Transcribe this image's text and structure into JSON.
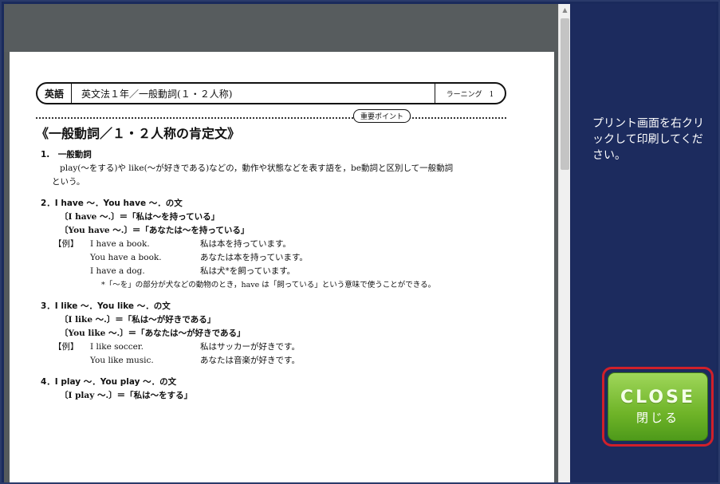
{
  "instruction": "プリント画面を右クリックして印刷してください。",
  "close_button": {
    "label_en": "CLOSE",
    "label_ja": "閉じる"
  },
  "document": {
    "subject": "英語",
    "title": "英文法１年／一般動詞(１・２人称)",
    "right_label": "ラーニング　1",
    "point_tag": "重要ポイント",
    "main_heading": "《一般動詞／１・２人称の肯定文》",
    "sections": [
      {
        "title": "1.　一般動詞",
        "lines": [
          "play(～をする)や like(～が好きである)などの，動作や状態などを表す語を，be動詞と区別して一般動詞",
          "という。"
        ]
      },
      {
        "title": "2．I have ～．You have ～．の文",
        "patterns": [
          "〔I have ～.〕＝「私は～を持っている」",
          "〔You have ～.〕＝「あなたは～を持っている」"
        ],
        "example_label": "【例】",
        "examples": [
          {
            "en": "I have a book.",
            "ja": "私は本を持っています。"
          },
          {
            "en": "You have a book.",
            "ja": "あなたは本を持っています。"
          },
          {
            "en": "I have a dog.",
            "ja": "私は犬*を飼っています。"
          }
        ],
        "note": "*「～を」の部分が犬などの動物のとき，have は「飼っている」という意味で使うことができる。"
      },
      {
        "title": "3．I like ～．You like ～．の文",
        "patterns": [
          "〔I like ～.〕＝「私は～が好きである」",
          "〔You like ～.〕＝「あなたは～が好きである」"
        ],
        "example_label": "【例】",
        "examples": [
          {
            "en": "I like soccer.",
            "ja": "私はサッカーが好きです。"
          },
          {
            "en": "You like music.",
            "ja": "あなたは音楽が好きです。"
          }
        ]
      },
      {
        "title": "4．I play ～．You play ～．の文",
        "patterns": [
          "〔I play ～.〕＝「私は～をする」"
        ]
      }
    ]
  }
}
